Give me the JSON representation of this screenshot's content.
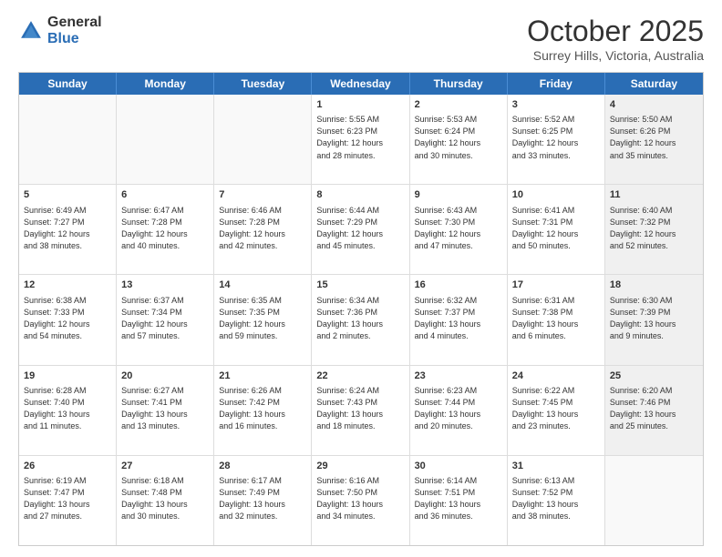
{
  "logo": {
    "general": "General",
    "blue": "Blue"
  },
  "header": {
    "month": "October 2025",
    "location": "Surrey Hills, Victoria, Australia"
  },
  "weekdays": [
    "Sunday",
    "Monday",
    "Tuesday",
    "Wednesday",
    "Thursday",
    "Friday",
    "Saturday"
  ],
  "rows": [
    [
      {
        "day": "",
        "lines": [],
        "empty": true
      },
      {
        "day": "",
        "lines": [],
        "empty": true
      },
      {
        "day": "",
        "lines": [],
        "empty": true
      },
      {
        "day": "1",
        "lines": [
          "Sunrise: 5:55 AM",
          "Sunset: 6:23 PM",
          "Daylight: 12 hours",
          "and 28 minutes."
        ],
        "empty": false
      },
      {
        "day": "2",
        "lines": [
          "Sunrise: 5:53 AM",
          "Sunset: 6:24 PM",
          "Daylight: 12 hours",
          "and 30 minutes."
        ],
        "empty": false
      },
      {
        "day": "3",
        "lines": [
          "Sunrise: 5:52 AM",
          "Sunset: 6:25 PM",
          "Daylight: 12 hours",
          "and 33 minutes."
        ],
        "empty": false
      },
      {
        "day": "4",
        "lines": [
          "Sunrise: 5:50 AM",
          "Sunset: 6:26 PM",
          "Daylight: 12 hours",
          "and 35 minutes."
        ],
        "empty": false,
        "shaded": true
      }
    ],
    [
      {
        "day": "5",
        "lines": [
          "Sunrise: 6:49 AM",
          "Sunset: 7:27 PM",
          "Daylight: 12 hours",
          "and 38 minutes."
        ],
        "empty": false
      },
      {
        "day": "6",
        "lines": [
          "Sunrise: 6:47 AM",
          "Sunset: 7:28 PM",
          "Daylight: 12 hours",
          "and 40 minutes."
        ],
        "empty": false
      },
      {
        "day": "7",
        "lines": [
          "Sunrise: 6:46 AM",
          "Sunset: 7:28 PM",
          "Daylight: 12 hours",
          "and 42 minutes."
        ],
        "empty": false
      },
      {
        "day": "8",
        "lines": [
          "Sunrise: 6:44 AM",
          "Sunset: 7:29 PM",
          "Daylight: 12 hours",
          "and 45 minutes."
        ],
        "empty": false
      },
      {
        "day": "9",
        "lines": [
          "Sunrise: 6:43 AM",
          "Sunset: 7:30 PM",
          "Daylight: 12 hours",
          "and 47 minutes."
        ],
        "empty": false
      },
      {
        "day": "10",
        "lines": [
          "Sunrise: 6:41 AM",
          "Sunset: 7:31 PM",
          "Daylight: 12 hours",
          "and 50 minutes."
        ],
        "empty": false
      },
      {
        "day": "11",
        "lines": [
          "Sunrise: 6:40 AM",
          "Sunset: 7:32 PM",
          "Daylight: 12 hours",
          "and 52 minutes."
        ],
        "empty": false,
        "shaded": true
      }
    ],
    [
      {
        "day": "12",
        "lines": [
          "Sunrise: 6:38 AM",
          "Sunset: 7:33 PM",
          "Daylight: 12 hours",
          "and 54 minutes."
        ],
        "empty": false
      },
      {
        "day": "13",
        "lines": [
          "Sunrise: 6:37 AM",
          "Sunset: 7:34 PM",
          "Daylight: 12 hours",
          "and 57 minutes."
        ],
        "empty": false
      },
      {
        "day": "14",
        "lines": [
          "Sunrise: 6:35 AM",
          "Sunset: 7:35 PM",
          "Daylight: 12 hours",
          "and 59 minutes."
        ],
        "empty": false
      },
      {
        "day": "15",
        "lines": [
          "Sunrise: 6:34 AM",
          "Sunset: 7:36 PM",
          "Daylight: 13 hours",
          "and 2 minutes."
        ],
        "empty": false
      },
      {
        "day": "16",
        "lines": [
          "Sunrise: 6:32 AM",
          "Sunset: 7:37 PM",
          "Daylight: 13 hours",
          "and 4 minutes."
        ],
        "empty": false
      },
      {
        "day": "17",
        "lines": [
          "Sunrise: 6:31 AM",
          "Sunset: 7:38 PM",
          "Daylight: 13 hours",
          "and 6 minutes."
        ],
        "empty": false
      },
      {
        "day": "18",
        "lines": [
          "Sunrise: 6:30 AM",
          "Sunset: 7:39 PM",
          "Daylight: 13 hours",
          "and 9 minutes."
        ],
        "empty": false,
        "shaded": true
      }
    ],
    [
      {
        "day": "19",
        "lines": [
          "Sunrise: 6:28 AM",
          "Sunset: 7:40 PM",
          "Daylight: 13 hours",
          "and 11 minutes."
        ],
        "empty": false
      },
      {
        "day": "20",
        "lines": [
          "Sunrise: 6:27 AM",
          "Sunset: 7:41 PM",
          "Daylight: 13 hours",
          "and 13 minutes."
        ],
        "empty": false
      },
      {
        "day": "21",
        "lines": [
          "Sunrise: 6:26 AM",
          "Sunset: 7:42 PM",
          "Daylight: 13 hours",
          "and 16 minutes."
        ],
        "empty": false
      },
      {
        "day": "22",
        "lines": [
          "Sunrise: 6:24 AM",
          "Sunset: 7:43 PM",
          "Daylight: 13 hours",
          "and 18 minutes."
        ],
        "empty": false
      },
      {
        "day": "23",
        "lines": [
          "Sunrise: 6:23 AM",
          "Sunset: 7:44 PM",
          "Daylight: 13 hours",
          "and 20 minutes."
        ],
        "empty": false
      },
      {
        "day": "24",
        "lines": [
          "Sunrise: 6:22 AM",
          "Sunset: 7:45 PM",
          "Daylight: 13 hours",
          "and 23 minutes."
        ],
        "empty": false
      },
      {
        "day": "25",
        "lines": [
          "Sunrise: 6:20 AM",
          "Sunset: 7:46 PM",
          "Daylight: 13 hours",
          "and 25 minutes."
        ],
        "empty": false,
        "shaded": true
      }
    ],
    [
      {
        "day": "26",
        "lines": [
          "Sunrise: 6:19 AM",
          "Sunset: 7:47 PM",
          "Daylight: 13 hours",
          "and 27 minutes."
        ],
        "empty": false
      },
      {
        "day": "27",
        "lines": [
          "Sunrise: 6:18 AM",
          "Sunset: 7:48 PM",
          "Daylight: 13 hours",
          "and 30 minutes."
        ],
        "empty": false
      },
      {
        "day": "28",
        "lines": [
          "Sunrise: 6:17 AM",
          "Sunset: 7:49 PM",
          "Daylight: 13 hours",
          "and 32 minutes."
        ],
        "empty": false
      },
      {
        "day": "29",
        "lines": [
          "Sunrise: 6:16 AM",
          "Sunset: 7:50 PM",
          "Daylight: 13 hours",
          "and 34 minutes."
        ],
        "empty": false
      },
      {
        "day": "30",
        "lines": [
          "Sunrise: 6:14 AM",
          "Sunset: 7:51 PM",
          "Daylight: 13 hours",
          "and 36 minutes."
        ],
        "empty": false
      },
      {
        "day": "31",
        "lines": [
          "Sunrise: 6:13 AM",
          "Sunset: 7:52 PM",
          "Daylight: 13 hours",
          "and 38 minutes."
        ],
        "empty": false
      },
      {
        "day": "",
        "lines": [],
        "empty": true,
        "shaded": true
      }
    ]
  ]
}
